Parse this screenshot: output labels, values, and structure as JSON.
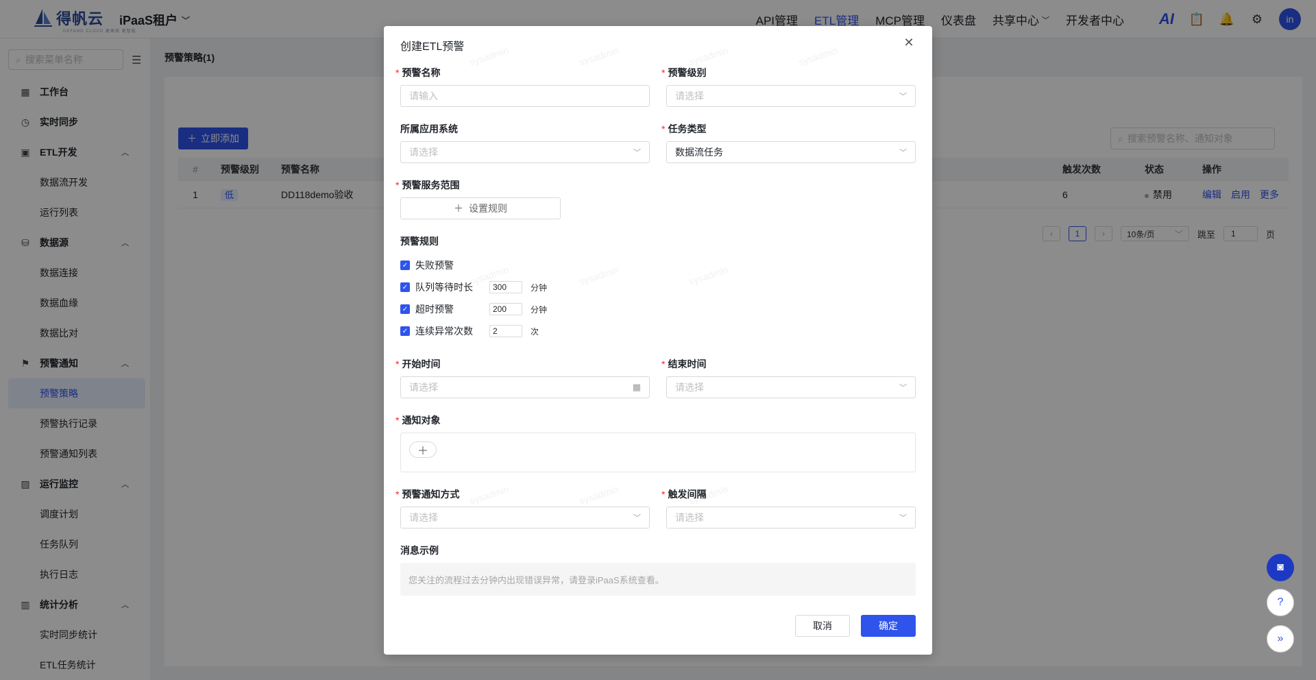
{
  "header": {
    "brand": "得帆云",
    "slogan": "DEFANG CLOUD 更高效 更智能",
    "tenant": "iPaaS租户",
    "nav": [
      "API管理",
      "ETL管理",
      "MCP管理",
      "仪表盘",
      "共享中心",
      "开发者中心"
    ],
    "active_nav": "ETL管理",
    "ai_label": "AI",
    "avatar": "in"
  },
  "sidebar": {
    "search_placeholder": "搜索菜单名称",
    "items": [
      {
        "label": "工作台",
        "icon": "dashboard-icon",
        "type": "top"
      },
      {
        "label": "实时同步",
        "icon": "clock-icon",
        "type": "top"
      },
      {
        "label": "ETL开发",
        "icon": "etl-icon",
        "type": "group"
      },
      {
        "label": "数据流开发",
        "type": "sub"
      },
      {
        "label": "运行列表",
        "type": "sub"
      },
      {
        "label": "数据源",
        "icon": "database-icon",
        "type": "group"
      },
      {
        "label": "数据连接",
        "type": "sub"
      },
      {
        "label": "数据血缘",
        "type": "sub"
      },
      {
        "label": "数据比对",
        "type": "sub"
      },
      {
        "label": "预警通知",
        "icon": "alarm-icon",
        "type": "group"
      },
      {
        "label": "预警策略",
        "type": "sub",
        "selected": true
      },
      {
        "label": "预警执行记录",
        "type": "sub"
      },
      {
        "label": "预警通知列表",
        "type": "sub"
      },
      {
        "label": "运行监控",
        "icon": "monitor-icon",
        "type": "group"
      },
      {
        "label": "调度计划",
        "type": "sub"
      },
      {
        "label": "任务队列",
        "type": "sub"
      },
      {
        "label": "执行日志",
        "type": "sub"
      },
      {
        "label": "统计分析",
        "icon": "bar-chart-icon",
        "type": "group"
      },
      {
        "label": "实时同步统计",
        "type": "sub"
      },
      {
        "label": "ETL任务统计",
        "type": "sub"
      }
    ]
  },
  "main": {
    "breadcrumb": "预警策略(1)",
    "add_button": "立即添加",
    "search_placeholder": "搜索预警名称、通知对象",
    "table": {
      "headers": [
        "#",
        "预警级别",
        "预警名称",
        "触发次数",
        "状态",
        "操作"
      ],
      "rows": [
        {
          "index": "1",
          "level": "低",
          "name": "DD118demo验收",
          "count": "6",
          "status": "禁用",
          "actions": [
            "编辑",
            "启用",
            "更多"
          ]
        }
      ]
    },
    "pager": {
      "current": "1",
      "size": "10条/页",
      "jump_label": "跳至",
      "jump_value": "1",
      "page_suffix": "页"
    }
  },
  "modal": {
    "title": "创建ETL预警",
    "fields": {
      "name_label": "预警名称",
      "name_placeholder": "请输入",
      "level_label": "预警级别",
      "level_placeholder": "请选择",
      "system_label": "所属应用系统",
      "system_placeholder": "请选择",
      "task_type_label": "任务类型",
      "task_type_value": "数据流任务",
      "scope_label": "预警服务范围",
      "scope_button": "设置规则",
      "rules_label": "预警规则",
      "start_label": "开始时间",
      "start_placeholder": "请选择",
      "end_label": "结束时间",
      "end_placeholder": "请选择",
      "notify_label": "通知对象",
      "method_label": "预警通知方式",
      "method_placeholder": "请选择",
      "interval_label": "触发间隔",
      "interval_placeholder": "请选择",
      "message_label": "消息示例",
      "message_text": "您关注的流程过去分钟内出现错误异常，请登录iPaaS系统查看。"
    },
    "rules": [
      {
        "label": "失败预警",
        "checked": true
      },
      {
        "label": "队列等待时长",
        "checked": true,
        "value": "300",
        "unit": "分钟"
      },
      {
        "label": "超时预警",
        "checked": true,
        "value": "200",
        "unit": "分钟"
      },
      {
        "label": "连续异常次数",
        "checked": true,
        "value": "2",
        "unit": "次"
      }
    ],
    "cancel": "取消",
    "confirm": "确定",
    "watermark": "sysadmin"
  }
}
